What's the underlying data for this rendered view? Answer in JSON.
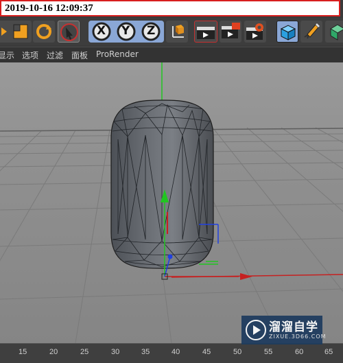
{
  "timestamp": "2019-10-16 12:09:37",
  "toolbar": {
    "icons": [
      "scale-icon",
      "rotate-icon",
      "select-icon",
      "x-axis-lock",
      "y-axis-lock",
      "z-axis-lock",
      "world-coordinates-icon",
      "render-view-icon",
      "render-picture-viewer-icon",
      "render-settings-icon",
      "cube-icon",
      "pen-icon",
      "subdivision-icon"
    ],
    "x_label": "X",
    "y_label": "Y",
    "z_label": "Z"
  },
  "menu": [
    "显示",
    "选项",
    "过滤",
    "面板",
    "ProRender"
  ],
  "timeline": {
    "ticks": [
      "15",
      "20",
      "25",
      "30",
      "35",
      "40",
      "45",
      "50",
      "55",
      "60",
      "65"
    ]
  },
  "watermark": {
    "name": "溜溜自学",
    "url": "ZIXUE.3D66.COM"
  },
  "colors": {
    "accent": "#d81e1e",
    "viewport": "#8f8f8f",
    "grid": "#6e6e6e",
    "x_axis": "#c62020",
    "y_axis": "#20c620",
    "z_axis": "#2040e0"
  }
}
